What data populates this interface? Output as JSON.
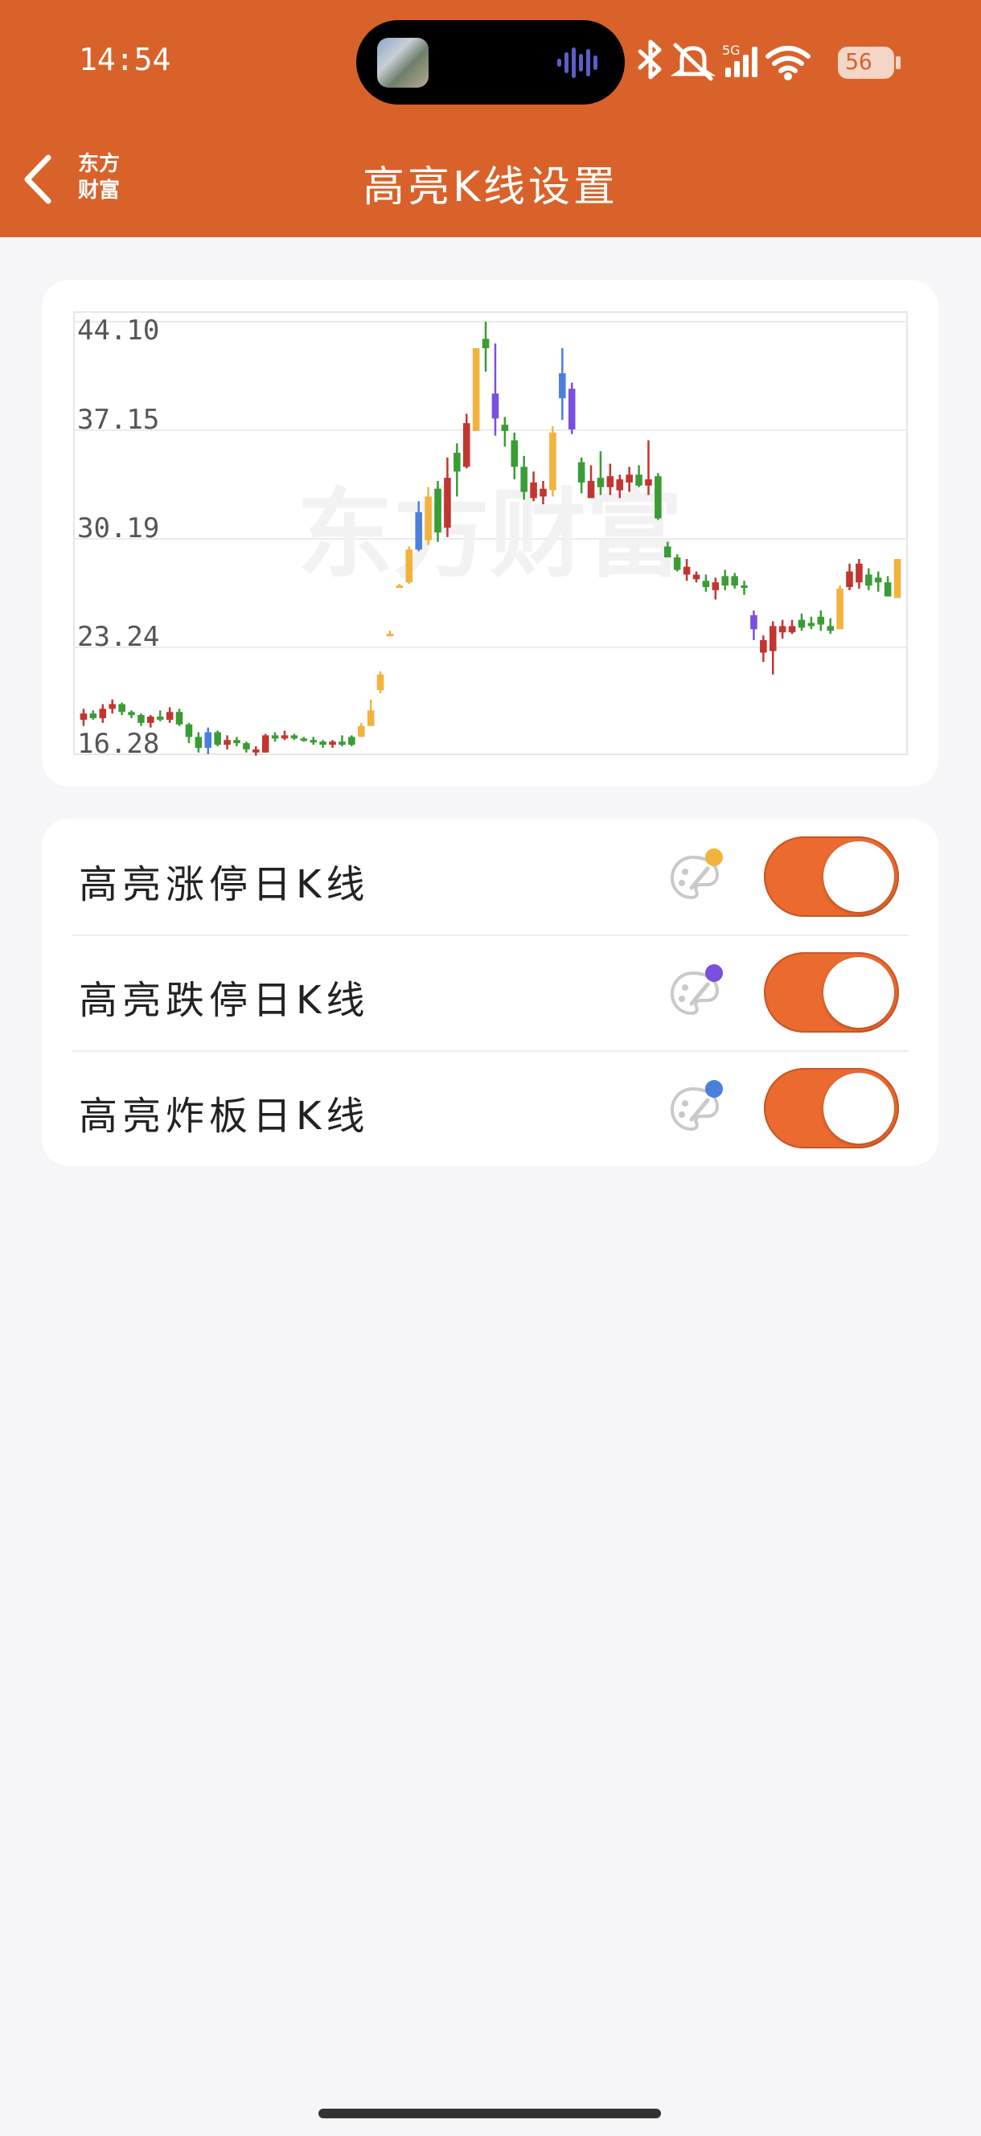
{
  "status_bar": {
    "time": "14:54",
    "battery": "56",
    "network": "5G",
    "icons": [
      "app-thumbnail",
      "audio-wave-icon",
      "bluetooth-icon",
      "bell-muted-icon",
      "signal-icon",
      "wifi-icon",
      "battery-icon"
    ]
  },
  "header": {
    "back_icon": "chevron-left-icon",
    "logo_line1": "东方",
    "logo_line2": "财富",
    "title": "高亮K线设置",
    "background": "#d9622a"
  },
  "chart_data": {
    "type": "candlestick",
    "watermark": "东方财富",
    "y_ticks": [
      "44.10",
      "37.15",
      "30.19",
      "23.24",
      "16.28"
    ],
    "ylim": [
      16.28,
      44.1
    ],
    "grid": true,
    "colors": {
      "up": "#c23531",
      "down": "#3a9c35",
      "limit_up": "#f2b33d",
      "limit_down": "#7b4fe0",
      "broken_board": "#4a7fdc"
    },
    "candles": [
      {
        "o": 18.6,
        "h": 19.3,
        "l": 18.2,
        "c": 19.0,
        "t": "up"
      },
      {
        "o": 19.0,
        "h": 19.2,
        "l": 18.6,
        "c": 18.7,
        "t": "down"
      },
      {
        "o": 18.7,
        "h": 19.6,
        "l": 18.4,
        "c": 19.3,
        "t": "up"
      },
      {
        "o": 19.3,
        "h": 19.9,
        "l": 19.0,
        "c": 19.6,
        "t": "up"
      },
      {
        "o": 19.6,
        "h": 19.7,
        "l": 18.9,
        "c": 19.1,
        "t": "down"
      },
      {
        "o": 19.1,
        "h": 19.2,
        "l": 18.7,
        "c": 18.9,
        "t": "down"
      },
      {
        "o": 18.9,
        "h": 19.0,
        "l": 18.2,
        "c": 18.4,
        "t": "down"
      },
      {
        "o": 18.4,
        "h": 18.9,
        "l": 18.1,
        "c": 18.8,
        "t": "up"
      },
      {
        "o": 18.8,
        "h": 19.2,
        "l": 18.5,
        "c": 18.6,
        "t": "down"
      },
      {
        "o": 18.6,
        "h": 19.4,
        "l": 18.4,
        "c": 19.1,
        "t": "up"
      },
      {
        "o": 19.1,
        "h": 19.3,
        "l": 18.2,
        "c": 18.3,
        "t": "down"
      },
      {
        "o": 18.3,
        "h": 18.4,
        "l": 17.1,
        "c": 17.5,
        "t": "down"
      },
      {
        "o": 17.5,
        "h": 17.8,
        "l": 16.5,
        "c": 16.8,
        "t": "down"
      },
      {
        "o": 16.8,
        "h": 18.1,
        "l": 16.4,
        "c": 17.8,
        "t": "bb"
      },
      {
        "o": 17.8,
        "h": 17.9,
        "l": 16.9,
        "c": 17.0,
        "t": "down"
      },
      {
        "o": 17.0,
        "h": 17.6,
        "l": 16.7,
        "c": 17.3,
        "t": "up"
      },
      {
        "o": 17.3,
        "h": 17.5,
        "l": 16.9,
        "c": 17.1,
        "t": "down"
      },
      {
        "o": 17.1,
        "h": 17.2,
        "l": 16.5,
        "c": 16.7,
        "t": "down"
      },
      {
        "o": 16.7,
        "h": 16.9,
        "l": 16.3,
        "c": 16.5,
        "t": "up"
      },
      {
        "o": 16.5,
        "h": 17.7,
        "l": 16.5,
        "c": 17.6,
        "t": "up"
      },
      {
        "o": 17.6,
        "h": 17.8,
        "l": 17.2,
        "c": 17.4,
        "t": "down"
      },
      {
        "o": 17.4,
        "h": 17.9,
        "l": 17.3,
        "c": 17.6,
        "t": "up"
      },
      {
        "o": 17.6,
        "h": 17.7,
        "l": 17.3,
        "c": 17.4,
        "t": "down"
      },
      {
        "o": 17.4,
        "h": 17.5,
        "l": 17.2,
        "c": 17.3,
        "t": "down"
      },
      {
        "o": 17.3,
        "h": 17.5,
        "l": 17.0,
        "c": 17.2,
        "t": "down"
      },
      {
        "o": 17.2,
        "h": 17.3,
        "l": 16.8,
        "c": 17.0,
        "t": "down"
      },
      {
        "o": 17.0,
        "h": 17.3,
        "l": 16.8,
        "c": 17.2,
        "t": "up"
      },
      {
        "o": 17.2,
        "h": 17.6,
        "l": 16.9,
        "c": 17.0,
        "t": "down"
      },
      {
        "o": 17.0,
        "h": 17.6,
        "l": 16.9,
        "c": 17.5,
        "t": "down"
      },
      {
        "o": 17.5,
        "h": 18.4,
        "l": 17.5,
        "c": 18.2,
        "t": "lu"
      },
      {
        "o": 18.2,
        "h": 19.9,
        "l": 18.2,
        "c": 19.2,
        "t": "lu"
      },
      {
        "o": 20.5,
        "h": 21.7,
        "l": 20.3,
        "c": 21.5,
        "t": "lu"
      },
      {
        "o": 24.0,
        "h": 24.3,
        "l": 24.0,
        "c": 24.1,
        "t": "lu"
      },
      {
        "o": 27.2,
        "h": 27.3,
        "l": 27.1,
        "c": 27.2,
        "t": "lu"
      },
      {
        "o": 27.4,
        "h": 29.7,
        "l": 27.3,
        "c": 29.5,
        "t": "lu"
      },
      {
        "o": 29.5,
        "h": 32.6,
        "l": 29.4,
        "c": 31.9,
        "t": "bb"
      },
      {
        "o": 30.1,
        "h": 33.5,
        "l": 29.8,
        "c": 32.9,
        "t": "lu"
      },
      {
        "o": 33.4,
        "h": 33.9,
        "l": 30.0,
        "c": 30.6,
        "t": "down"
      },
      {
        "o": 30.9,
        "h": 35.4,
        "l": 30.3,
        "c": 34.1,
        "t": "up"
      },
      {
        "o": 34.5,
        "h": 36.3,
        "l": 32.9,
        "c": 35.7,
        "t": "down"
      },
      {
        "o": 34.8,
        "h": 38.2,
        "l": 34.7,
        "c": 37.6,
        "t": "up"
      },
      {
        "o": 37.1,
        "h": 42.4,
        "l": 37.1,
        "c": 42.4,
        "t": "lu"
      },
      {
        "o": 42.4,
        "h": 44.1,
        "l": 40.9,
        "c": 43.0,
        "t": "down"
      },
      {
        "o": 39.5,
        "h": 42.7,
        "l": 36.8,
        "c": 37.9,
        "t": "ld"
      },
      {
        "o": 37.1,
        "h": 38.0,
        "l": 36.1,
        "c": 37.5,
        "t": "down"
      },
      {
        "o": 36.5,
        "h": 37.0,
        "l": 34.0,
        "c": 34.8,
        "t": "down"
      },
      {
        "o": 34.8,
        "h": 35.5,
        "l": 32.7,
        "c": 33.2,
        "t": "down"
      },
      {
        "o": 32.8,
        "h": 34.5,
        "l": 32.6,
        "c": 33.8,
        "t": "up"
      },
      {
        "o": 33.4,
        "h": 33.9,
        "l": 32.4,
        "c": 32.9,
        "t": "up"
      },
      {
        "o": 33.3,
        "h": 37.4,
        "l": 32.9,
        "c": 37.0,
        "t": "lu"
      },
      {
        "o": 39.2,
        "h": 42.4,
        "l": 37.8,
        "c": 40.8,
        "t": "bb"
      },
      {
        "o": 39.8,
        "h": 40.2,
        "l": 36.9,
        "c": 37.2,
        "t": "ld"
      },
      {
        "o": 35.1,
        "h": 35.4,
        "l": 33.1,
        "c": 33.8,
        "t": "down"
      },
      {
        "o": 32.8,
        "h": 34.9,
        "l": 32.8,
        "c": 33.9,
        "t": "up"
      },
      {
        "o": 34.1,
        "h": 35.8,
        "l": 33.0,
        "c": 33.5,
        "t": "down"
      },
      {
        "o": 33.5,
        "h": 35.0,
        "l": 33.0,
        "c": 34.2,
        "t": "up"
      },
      {
        "o": 34.0,
        "h": 34.3,
        "l": 32.8,
        "c": 33.3,
        "t": "up"
      },
      {
        "o": 34.3,
        "h": 34.8,
        "l": 33.2,
        "c": 33.8,
        "t": "up"
      },
      {
        "o": 33.6,
        "h": 34.9,
        "l": 33.5,
        "c": 34.3,
        "t": "down"
      },
      {
        "o": 34.0,
        "h": 36.5,
        "l": 33.0,
        "c": 33.6,
        "t": "up"
      },
      {
        "o": 34.2,
        "h": 34.4,
        "l": 31.4,
        "c": 31.5,
        "t": "down"
      },
      {
        "o": 29.7,
        "h": 30.0,
        "l": 29.0,
        "c": 29.0,
        "t": "down"
      },
      {
        "o": 29.0,
        "h": 29.2,
        "l": 28.1,
        "c": 28.2,
        "t": "down"
      },
      {
        "o": 28.4,
        "h": 28.9,
        "l": 27.5,
        "c": 27.9,
        "t": "up"
      },
      {
        "o": 27.9,
        "h": 28.1,
        "l": 27.4,
        "c": 27.6,
        "t": "up"
      },
      {
        "o": 27.5,
        "h": 27.9,
        "l": 26.8,
        "c": 27.1,
        "t": "down"
      },
      {
        "o": 27.4,
        "h": 27.7,
        "l": 26.3,
        "c": 26.9,
        "t": "up"
      },
      {
        "o": 27.2,
        "h": 28.2,
        "l": 26.9,
        "c": 27.8,
        "t": "down"
      },
      {
        "o": 27.8,
        "h": 28.0,
        "l": 27.0,
        "c": 27.2,
        "t": "down"
      },
      {
        "o": 27.2,
        "h": 27.5,
        "l": 26.6,
        "c": 27.1,
        "t": "down"
      },
      {
        "o": 25.3,
        "h": 25.6,
        "l": 23.7,
        "c": 24.4,
        "t": "ld"
      },
      {
        "o": 23.7,
        "h": 24.0,
        "l": 22.3,
        "c": 22.9,
        "t": "up"
      },
      {
        "o": 23.0,
        "h": 24.9,
        "l": 21.5,
        "c": 24.6,
        "t": "up"
      },
      {
        "o": 24.2,
        "h": 25.0,
        "l": 23.8,
        "c": 24.6,
        "t": "up"
      },
      {
        "o": 24.6,
        "h": 25.0,
        "l": 24.1,
        "c": 24.2,
        "t": "up"
      },
      {
        "o": 24.5,
        "h": 25.4,
        "l": 24.3,
        "c": 25.0,
        "t": "down"
      },
      {
        "o": 24.8,
        "h": 25.2,
        "l": 24.4,
        "c": 24.6,
        "t": "down"
      },
      {
        "o": 24.7,
        "h": 25.6,
        "l": 24.3,
        "c": 25.2,
        "t": "down"
      },
      {
        "o": 24.6,
        "h": 25.1,
        "l": 24.1,
        "c": 24.3,
        "t": "down"
      },
      {
        "o": 24.4,
        "h": 27.2,
        "l": 24.4,
        "c": 27.0,
        "t": "lu"
      },
      {
        "o": 27.1,
        "h": 28.6,
        "l": 26.9,
        "c": 28.1,
        "t": "up"
      },
      {
        "o": 27.4,
        "h": 28.9,
        "l": 27.0,
        "c": 28.6,
        "t": "up"
      },
      {
        "o": 27.9,
        "h": 28.3,
        "l": 26.9,
        "c": 27.2,
        "t": "down"
      },
      {
        "o": 27.7,
        "h": 28.1,
        "l": 26.8,
        "c": 27.4,
        "t": "down"
      },
      {
        "o": 27.4,
        "h": 27.8,
        "l": 26.5,
        "c": 26.5,
        "t": "down"
      },
      {
        "o": 26.4,
        "h": 28.9,
        "l": 26.4,
        "c": 28.9,
        "t": "lu"
      }
    ]
  },
  "settings": {
    "items": [
      {
        "label": "高亮涨停日K线",
        "dot_color": "#f2b33d",
        "enabled": true
      },
      {
        "label": "高亮跌停日K线",
        "dot_color": "#7b4fe0",
        "enabled": true
      },
      {
        "label": "高亮炸板日K线",
        "dot_color": "#4a7fdc",
        "enabled": true
      }
    ],
    "toggle_on_color": "#eb6a2f"
  }
}
